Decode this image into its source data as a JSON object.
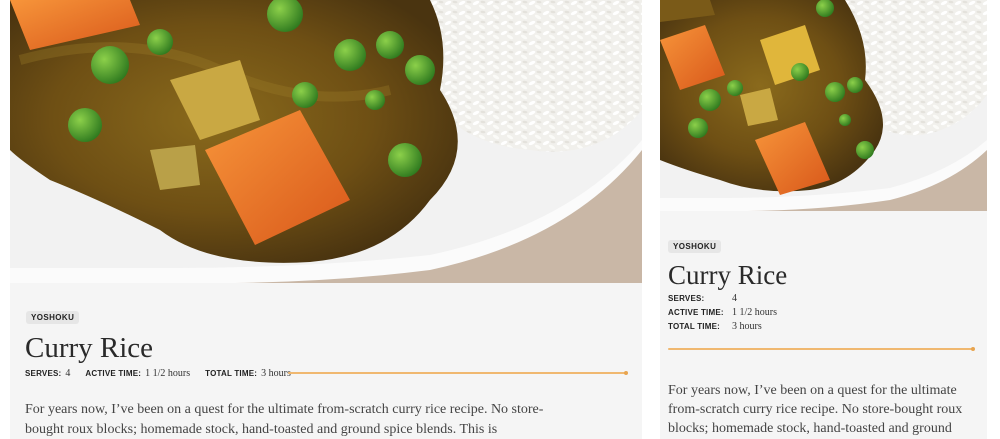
{
  "recipe": {
    "tag": "YOSHOKU",
    "title": "Curry Rice",
    "meta": {
      "serves_label": "SERVES:",
      "serves_value": "4",
      "active_label": "ACTIVE TIME:",
      "active_value": "1 1/2 hours",
      "total_label": "TOTAL TIME:",
      "total_value": "3 hours"
    },
    "intro_wide": "For years now, I’ve been on a quest for the ultimate from-scratch curry rice recipe. No store-bought roux blocks; homemade stock, hand-toasted and ground spice blends. This is",
    "intro_narrow": "For years now, I’ve been on a quest for the ultimate from-scratch curry rice recipe. No store-bought roux blocks; homemade stock, hand-toasted and ground spice"
  },
  "photo": {
    "icon": "curry-rice-photo"
  },
  "colors": {
    "accent_rule": "#f0b870",
    "card_bg": "#f5f5f5",
    "tag_bg": "#e6e6e6"
  }
}
